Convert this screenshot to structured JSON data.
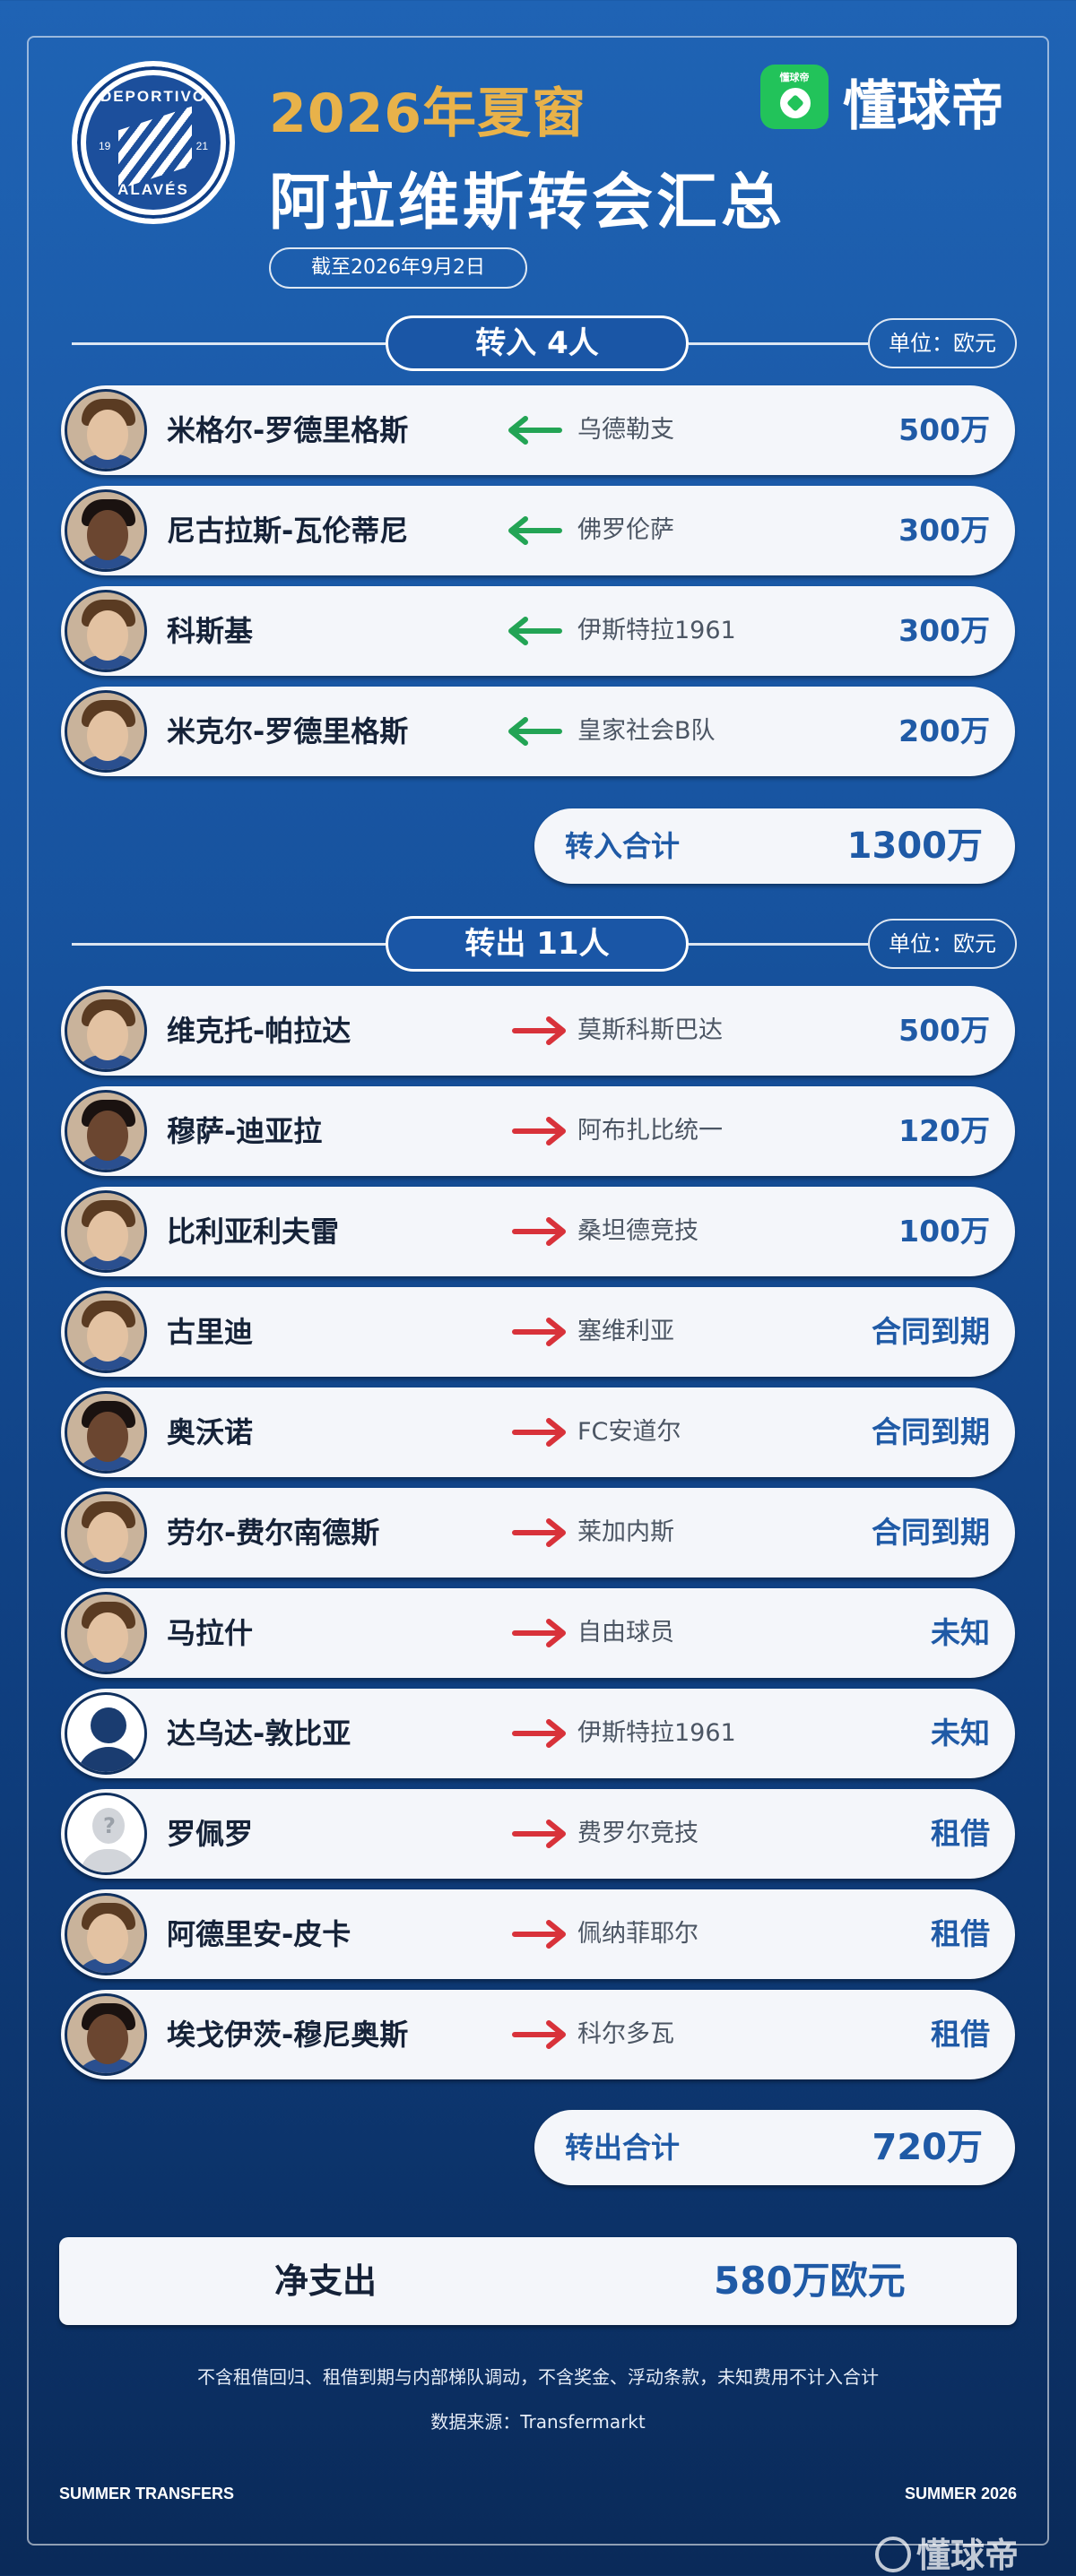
{
  "header": {
    "season": "2026年夏窗",
    "title": "阿拉维斯转会汇总",
    "date": "截至2026年9月2日",
    "brand_icon_text": "懂球帝",
    "brand_name": "懂球帝",
    "club_logo": {
      "top_text": "DEPORTIVO",
      "bottom_text": "ALAVÉS",
      "year_left": "19",
      "year_right": "21"
    }
  },
  "colors": {
    "accent_gold": "#e8b24a",
    "fee_blue": "#1f5aa6",
    "in_arrow": "#23a455",
    "out_arrow": "#d8323a",
    "brand_green": "#22c35a"
  },
  "transfers_in": {
    "label": "转入 4人",
    "unit": "单位：欧元",
    "rows": [
      {
        "name": "米格尔-罗德里格斯",
        "club": "乌德勒支",
        "fee": "500万",
        "avatar": "player-photo"
      },
      {
        "name": "尼古拉斯-瓦伦蒂尼",
        "club": "佛罗伦萨",
        "fee": "300万",
        "avatar": "player-photo"
      },
      {
        "name": "科斯基",
        "club": "伊斯特拉1961",
        "fee": "300万",
        "avatar": "player-photo"
      },
      {
        "name": "米克尔-罗德里格斯",
        "club": "皇家社会B队",
        "fee": "200万",
        "avatar": "player-photo"
      }
    ],
    "total_label": "转入合计",
    "total_value": "1300万"
  },
  "transfers_out": {
    "label": "转出 11人",
    "unit": "单位：欧元",
    "rows": [
      {
        "name": "维克托-帕拉达",
        "club": "莫斯科斯巴达",
        "fee": "500万",
        "avatar": "player-photo"
      },
      {
        "name": "穆萨-迪亚拉",
        "club": "阿布扎比统一",
        "fee": "120万",
        "avatar": "player-photo"
      },
      {
        "name": "比利亚利夫雷",
        "club": "桑坦德竞技",
        "fee": "100万",
        "avatar": "player-photo"
      },
      {
        "name": "古里迪",
        "club": "塞维利亚",
        "fee": "合同到期",
        "avatar": "player-photo"
      },
      {
        "name": "奥沃诺",
        "club": "FC安道尔",
        "fee": "合同到期",
        "avatar": "player-photo"
      },
      {
        "name": "劳尔-费尔南德斯",
        "club": "莱加内斯",
        "fee": "合同到期",
        "avatar": "player-photo"
      },
      {
        "name": "马拉什",
        "club": "自由球员",
        "fee": "未知",
        "avatar": "player-photo"
      },
      {
        "name": "达乌达-敦比亚",
        "club": "伊斯特拉1961",
        "fee": "未知",
        "avatar": "silhouette"
      },
      {
        "name": "罗佩罗",
        "club": "费罗尔竞技",
        "fee": "租借",
        "avatar": "unknown"
      },
      {
        "name": "阿德里安-皮卡",
        "club": "佩纳菲耶尔",
        "fee": "租借",
        "avatar": "player-photo"
      },
      {
        "name": "埃戈伊茨-穆尼奥斯",
        "club": "科尔多瓦",
        "fee": "租借",
        "avatar": "player-photo"
      }
    ],
    "total_label": "转出合计",
    "total_value": "720万"
  },
  "net": {
    "label": "净支出",
    "value": "580万欧元"
  },
  "footer": {
    "note": "不含租借回归、租借到期与内部梯队调动，不含奖金、浮动条款，未知费用不计入合计",
    "source": "数据来源：Transfermarkt",
    "left": "SUMMER TRANSFERS",
    "right": "SUMMER 2026",
    "watermark": "懂球帝"
  }
}
